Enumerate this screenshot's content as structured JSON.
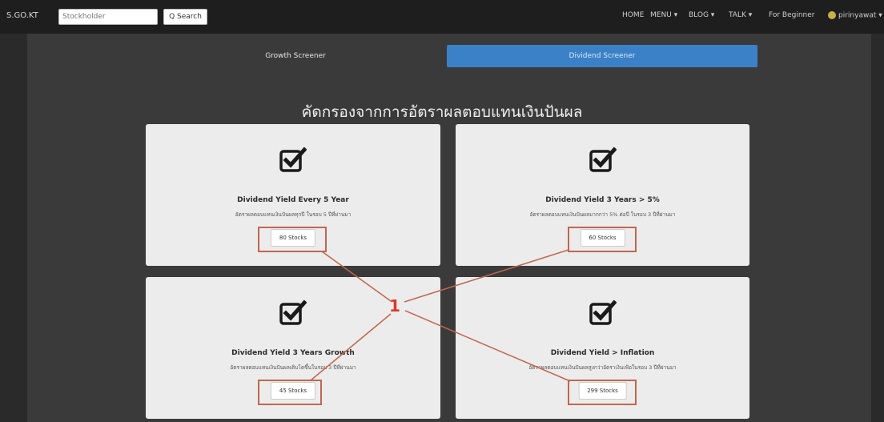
{
  "topbar": {
    "brand": "S.GO.KT",
    "search_placeholder": "Stockholder",
    "search_button": "Q Search",
    "nav_items": [
      "HOME",
      "MENU ▾",
      "BLOG ▾",
      "TALK ▾",
      "For Beginner"
    ],
    "user_label": "pirinyawat ▾"
  },
  "tabs": {
    "growth_label": "Growth Screener",
    "dividend_label": "Dividend Screener",
    "active": "dividend"
  },
  "heading": "คัดกรองจากการอัตราผลตอบแทนเงินปันผล",
  "cards": [
    {
      "title": "Dividend Yield Every 5 Year",
      "description": "อัตราผลตอบแทนเงินปันผลทุกปี ในรอบ 5 ปีที่ผ่านมา",
      "count": "80 Stocks"
    },
    {
      "title": "Dividend Yield 3 Years > 5%",
      "description": "อัตราผลตอบแทนเงินปันผลมากกว่า 5% ต่อปี ในรอบ 3 ปีที่ผ่านมา",
      "count": "60 Stocks"
    },
    {
      "title": "Dividend Yield 3 Years Growth",
      "description": "อัตราผลตอบแทนเงินปันผลเติบโตขึ้นในรอบ 3 ปีที่ผ่านมา",
      "count": "45 Stocks"
    },
    {
      "title": "Dividend Yield > Inflation",
      "description": "อัตราผลตอบแทนเงินปันผลสูงกว่าอัตราเงินเฟ้อในรอบ 3 ปีที่ผ่านมา",
      "count": "299 Stocks"
    }
  ],
  "annotation": {
    "marker": "1",
    "color": "#d93a2a"
  },
  "colors": {
    "accent_tab": "#3b81c8",
    "background": "#3a3a3a",
    "card": "#ececec",
    "highlight": "#c0674f"
  }
}
